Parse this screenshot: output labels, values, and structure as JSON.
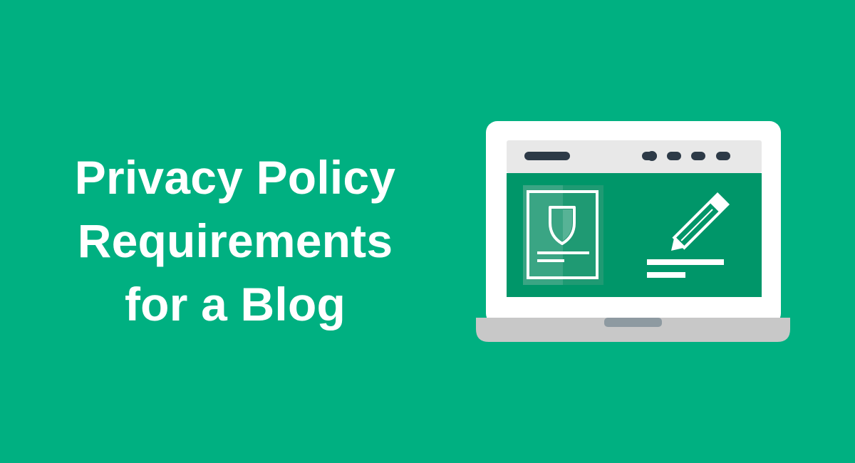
{
  "headline": {
    "lines": [
      "Privacy Policy",
      "Requirements",
      "for a Blog"
    ]
  },
  "colors": {
    "background": "#00b081",
    "headline_text": "#ffffff",
    "laptop_frame": "#ffffff",
    "laptop_base": "#c8c8c8",
    "laptop_notch": "#8e9aa1",
    "browser_bar": "#e8e8e8",
    "browser_controls": "#2d3a47",
    "screen": "#009669",
    "illustration_lines": "#ffffff"
  },
  "icons": {
    "laptop": "laptop-icon",
    "document": "policy-document-icon",
    "shield": "shield-icon",
    "pencil": "pencil-icon"
  }
}
